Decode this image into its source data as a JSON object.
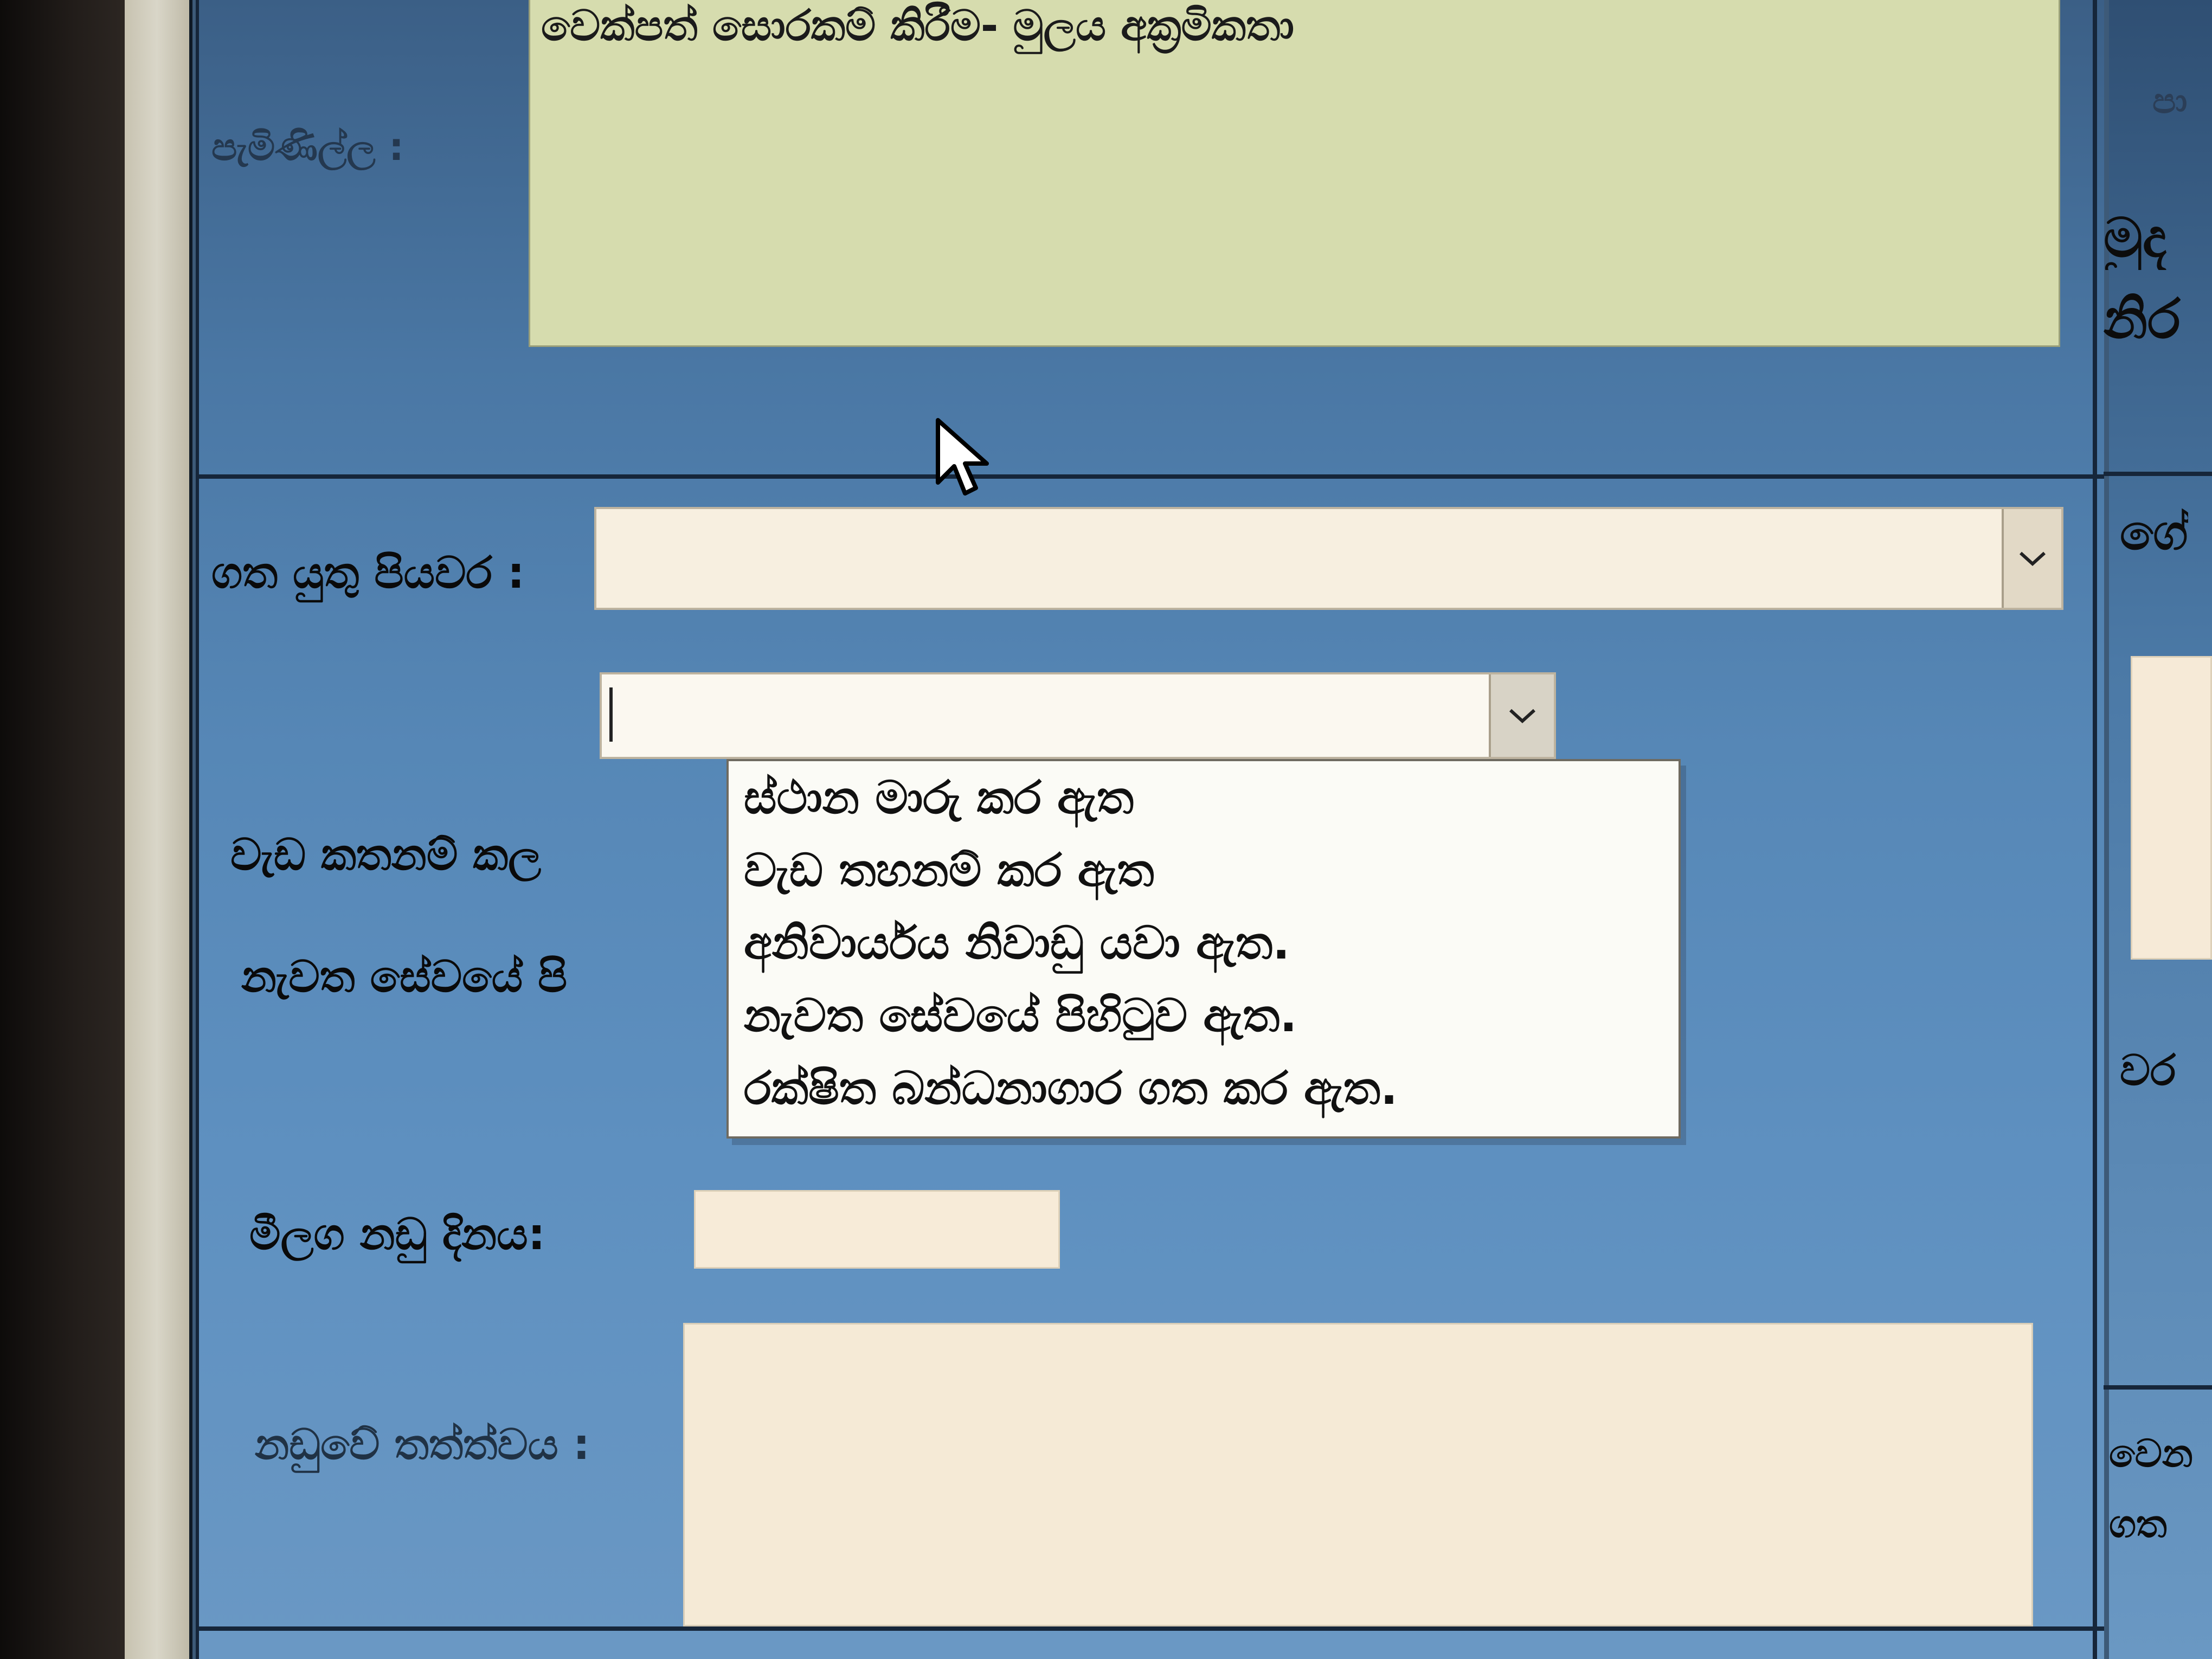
{
  "form": {
    "complaint_label": "පැමිණිල්ල :",
    "complaint_text": "වෙක්පත් සොරකම් කිරීම- මුලය අක්‍රමිකතා",
    "action_label": "ගත යුතු පියවර :",
    "action_selected": "",
    "work_done_label": "වැඩ කතනම් කල",
    "again_service_label": "නැවත සේවයේ පි",
    "next_date_label": "මීලග නඩු දිනය:",
    "next_date_value": "",
    "case_status_label": "නඩුවේ තත්ත්වය :",
    "case_status_value": ""
  },
  "status_dropdown": {
    "selected": "",
    "options": [
      "ස්ථාන මාරු කර ඇත",
      "වැඩ තහනම් කර ඇත",
      "අනිවාර්යය නිවාඩු යවා ඇත.",
      "නැවත සේවයේ පිහිටුව ඇත.",
      "රක්ෂිත බන්ධනාගාර ගත කර ඇත."
    ]
  },
  "right_column": {
    "label_1": "පා",
    "label_2": "මුද",
    "label_3": "නිර",
    "label_4": "ගේ",
    "label_5": "වර",
    "label_6": "වෙන",
    "label_7": "ගත"
  },
  "icons": {
    "select_arrow": "chevron-down-icon",
    "pointer": "mouse-cursor-icon"
  }
}
